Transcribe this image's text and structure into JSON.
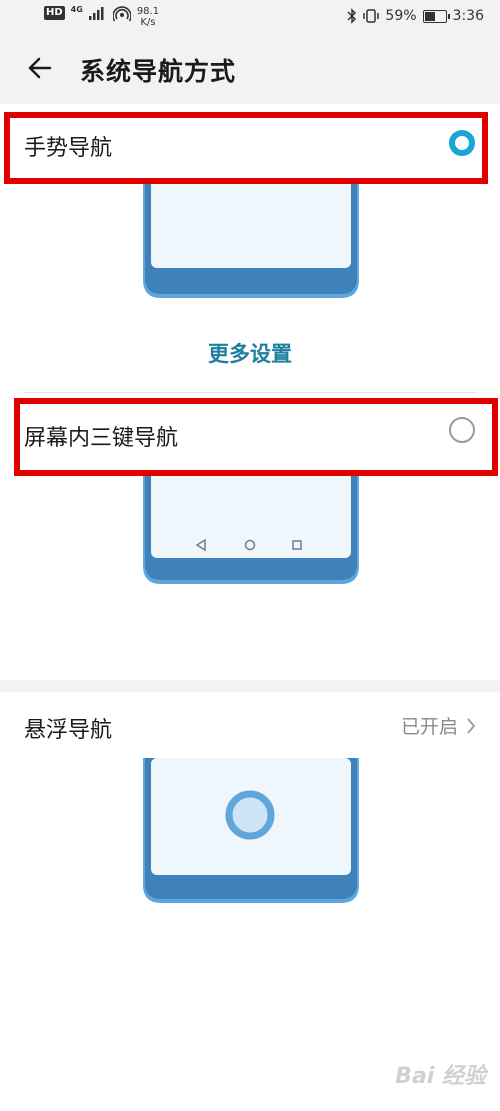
{
  "status_bar": {
    "hd": "HD",
    "network_type": "4G",
    "speed_value": "98.1",
    "speed_unit": "K/s",
    "battery_percent": "59%",
    "battery_level": 0.59,
    "time": "3:36"
  },
  "header": {
    "title": "系统导航方式"
  },
  "options": {
    "gesture": {
      "label": "手势导航",
      "selected": true
    },
    "more_settings": "更多设置",
    "three_key": {
      "label": "屏幕内三键导航",
      "selected": false
    },
    "floating": {
      "label": "悬浮导航",
      "status": "已开启"
    }
  },
  "watermark": "Bai 经验",
  "colors": {
    "accent": "#1aa4d8",
    "link": "#1e7fa0",
    "highlight": "#e00000",
    "phone_frame": "#5ea6dc",
    "phone_screen": "#eff6fc"
  }
}
